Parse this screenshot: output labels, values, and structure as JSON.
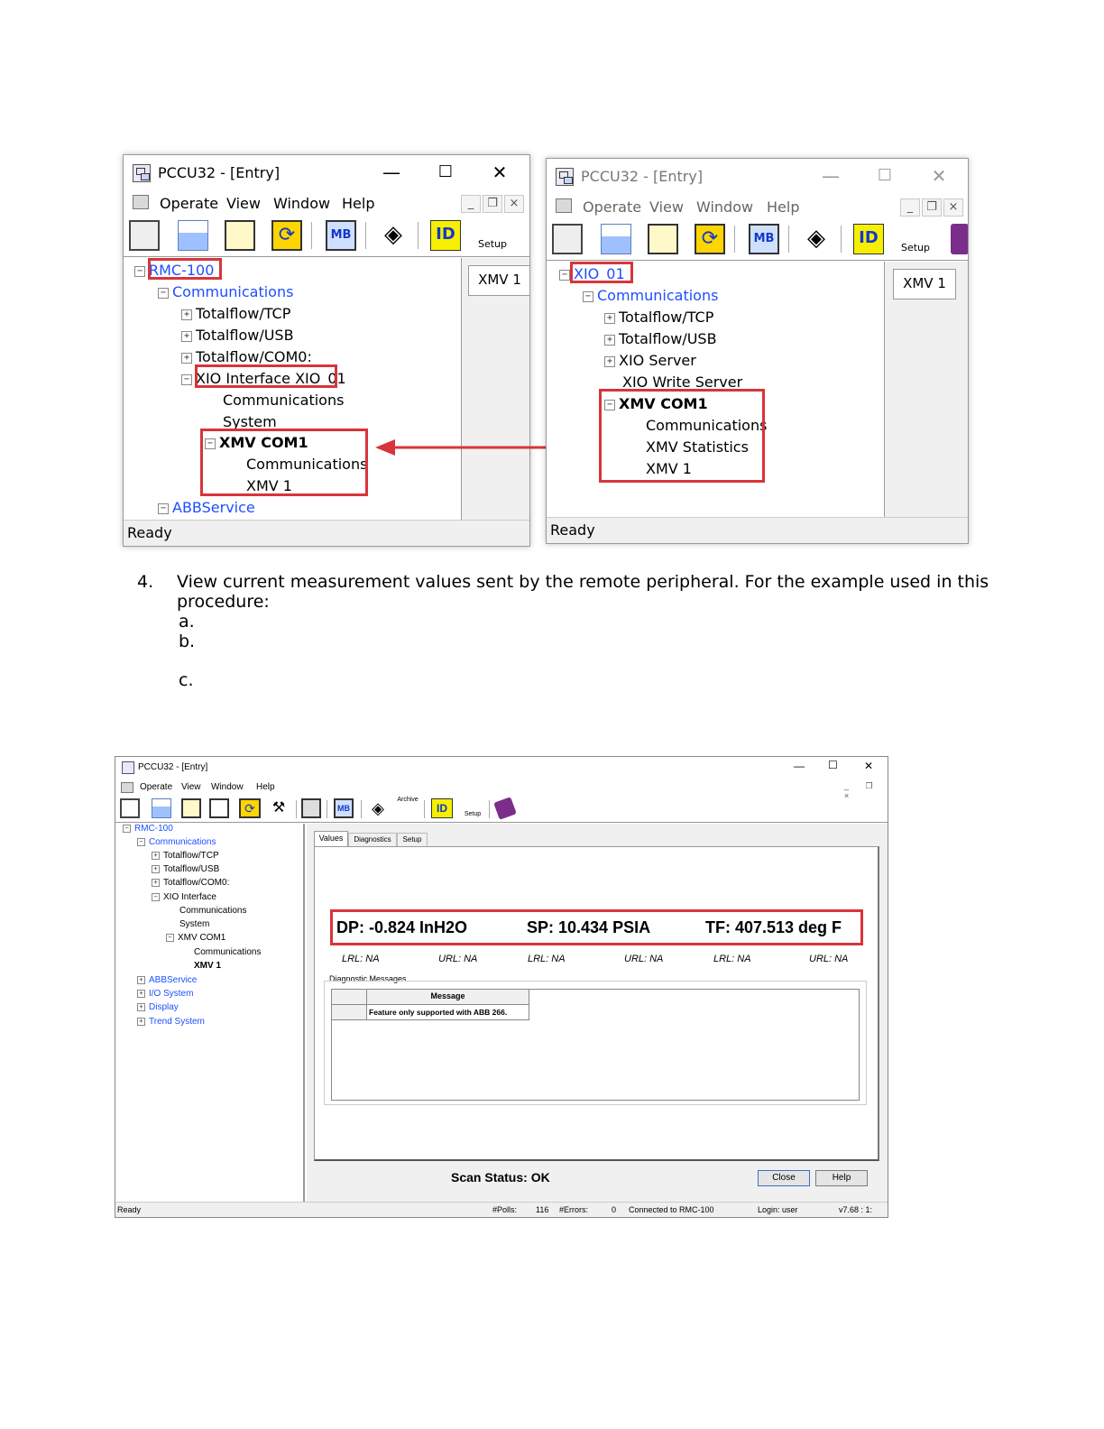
{
  "win1": {
    "title": "PCCU32 - [Entry]",
    "menu": [
      "Operate",
      "View",
      "Window",
      "Help"
    ],
    "setup_label": "Setup",
    "tree": {
      "root": "RMC-100",
      "communications": "Communications",
      "tcp": "Totalflow/TCP",
      "usb": "Totalflow/USB",
      "com0": "Totalflow/COM0:",
      "xio": "XIO Interface XIO_01",
      "xio_comm": "Communications",
      "xio_system": "System",
      "xmv_com1": "XMV COM1",
      "xmv_comm": "Communications",
      "xmv1": "XMV 1",
      "abb": "ABBService"
    },
    "tab": "XMV 1",
    "status": "Ready"
  },
  "win2": {
    "title": "PCCU32 - [Entry]",
    "menu": [
      "Operate",
      "View",
      "Window",
      "Help"
    ],
    "setup_label": "Setup",
    "tree": {
      "root": "XIO_01",
      "communications": "Communications",
      "tcp": "Totalflow/TCP",
      "usb": "Totalflow/USB",
      "server": "XIO Server",
      "write": "XIO Write Server",
      "xmv_com1": "XMV COM1",
      "xmv_comm": "Communications",
      "xmv_stats": "XMV Statistics",
      "xmv1": "XMV 1"
    },
    "tab": "XMV 1",
    "status": "Ready"
  },
  "step": {
    "number": "4.",
    "text_line1": "View current measurement values sent by the remote peripheral. For the example used in this",
    "text_line2": "procedure:",
    "a": "a.",
    "b": "b.",
    "c": "c."
  },
  "win3": {
    "title": "PCCU32 - [Entry]",
    "menu": [
      "Operate",
      "View",
      "Window",
      "Help"
    ],
    "archive_label": "Archive",
    "setup_label": "Setup",
    "tree": {
      "root": "RMC-100",
      "communications": "Communications",
      "tcp": "Totalflow/TCP",
      "usb": "Totalflow/USB",
      "com0": "Totalflow/COM0:",
      "xio": "XIO Interface",
      "xio_comm": "Communications",
      "xio_system": "System",
      "xmv_com1": "XMV COM1",
      "xmv_comm": "Communications",
      "xmv1": "XMV 1",
      "abb": "ABBService",
      "io": "I/O System",
      "display": "Display",
      "trend": "Trend System"
    },
    "tabs": [
      "Values",
      "Diagnostics",
      "Setup"
    ],
    "values": {
      "dp": "DP: -0.824 InH2O",
      "sp": "SP: 10.434 PSIA",
      "tf": "TF: 407.513 deg F"
    },
    "limits": [
      "LRL: NA",
      "URL: NA",
      "LRL: NA",
      "URL: NA",
      "LRL: NA",
      "URL: NA"
    ],
    "diag_title": "Diagnostic Messages",
    "diag_header": "Message",
    "diag_row": "Feature only supported with ABB 266.",
    "scan_status": "Scan Status: OK",
    "close_btn": "Close",
    "help_btn": "Help",
    "status": {
      "ready": "Ready",
      "polls_label": "#Polls:",
      "polls": "116",
      "errors_label": "#Errors:",
      "errors": "0",
      "connected": "Connected to RMC-100",
      "login": "Login: user",
      "version": "v7.68 : 1:"
    }
  }
}
